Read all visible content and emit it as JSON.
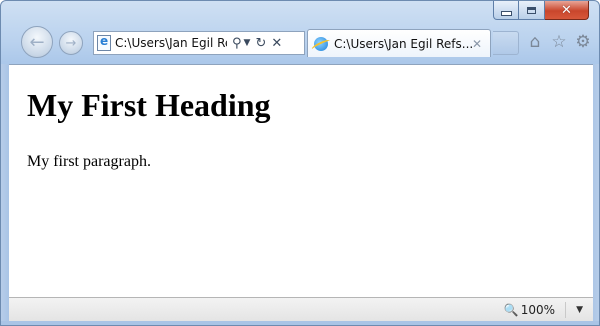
{
  "window": {
    "caption_buttons": {
      "minimize_icon": "minimize-icon",
      "maximize_icon": "maximize-icon",
      "close_glyph": "✕"
    }
  },
  "navigation": {
    "back_glyph": "←",
    "forward_glyph": "→",
    "address_text": "C:\\Users\\Jan Egil Re",
    "search_glyph": "⚲",
    "dropdown_glyph": "▼",
    "refresh_glyph": "↻",
    "stop_glyph": "✕"
  },
  "tab": {
    "title": "C:\\Users\\Jan Egil Refs...",
    "close_glyph": "✕"
  },
  "toolbar": {
    "home_glyph": "⌂",
    "favorites_glyph": "☆",
    "tools_glyph": "⚙"
  },
  "page": {
    "heading": "My First Heading",
    "paragraph": "My first paragraph."
  },
  "status_bar": {
    "zoom_icon_glyph": "🔍",
    "zoom_level": "100%",
    "zoom_dropdown_glyph": "▼"
  },
  "colors": {
    "frame": "#a9c6e9",
    "close_button": "#c9462c",
    "content_background": "#ffffff"
  }
}
